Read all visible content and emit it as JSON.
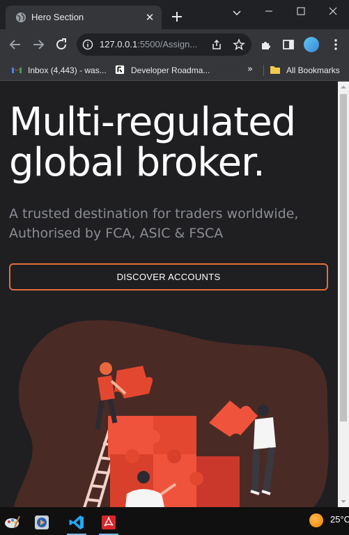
{
  "browser": {
    "tab": {
      "title": "Hero Section",
      "close_glyph": "✕"
    },
    "url": {
      "host": "127.0.0.1",
      "rest": ":5500/Assign..."
    },
    "bookmarks": [
      {
        "label": "Inbox (4,443) - was...",
        "icon": "gmail-icon"
      },
      {
        "label": "Developer Roadma...",
        "icon": "roadmap-icon"
      }
    ],
    "bookmarks_more": "»",
    "all_bookmarks": "All Bookmarks"
  },
  "hero": {
    "title": "Multi-regulated global broker.",
    "subtitle": "A trusted destination for traders worldwide, Authorised by FCA, ASIC & FSCA",
    "cta_label": "DISCOVER ACCOUNTS",
    "accent_color": "#e0703c",
    "blob_color": "#4a2a25"
  },
  "taskbar": {
    "temperature": "25°C",
    "apps": [
      "paint-icon",
      "media-player-icon",
      "vscode-icon",
      "acrobat-icon"
    ]
  }
}
